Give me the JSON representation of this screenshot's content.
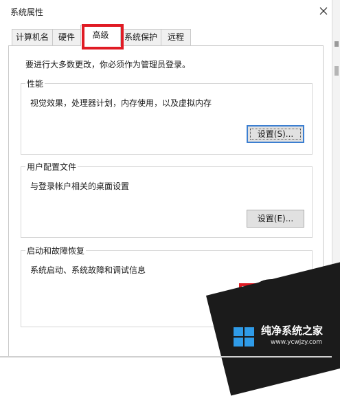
{
  "window": {
    "title": "系统属性"
  },
  "tabs": [
    {
      "label": "计算机名"
    },
    {
      "label": "硬件"
    },
    {
      "label": "高级"
    },
    {
      "label": "系统保护"
    },
    {
      "label": "远程"
    }
  ],
  "active_tab": "高级",
  "admin_note": "要进行大多数更改，你必须作为管理员登录。",
  "performance": {
    "title": "性能",
    "description": "视觉效果，处理器计划，内存使用，以及虚拟内存",
    "button": "设置(S)..."
  },
  "user_profiles": {
    "title": "用户配置文件",
    "description": "与登录帐户相关的桌面设置",
    "button": "设置(E)..."
  },
  "startup_recovery": {
    "title": "启动和故障恢复",
    "description": "系统启动、系统故障和调试信息"
  },
  "watermark": {
    "title": "纯净系统之家",
    "url": "www.ycwjzy.com"
  },
  "colors": {
    "highlight": "#e01b24",
    "focus": "#3c7fd1"
  }
}
